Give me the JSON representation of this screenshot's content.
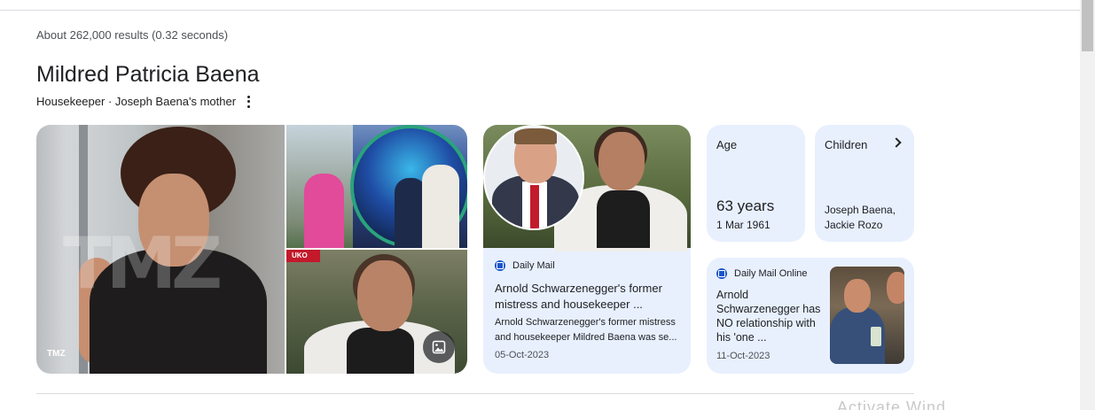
{
  "search": {
    "result_stats": "About 262,000 results (0.32 seconds)"
  },
  "entity": {
    "title": "Mildred Patricia Baena",
    "subtitle": "Housekeeper · Joseph Baena's mother"
  },
  "images": {
    "main_credit": "TMZ",
    "main_watermark": "TMZ",
    "bottom_tag": "UKO"
  },
  "news_card": {
    "source": "Daily Mail",
    "headline": "Arnold Schwarzenegger's former mistress and housekeeper ...",
    "snippet": "Arnold Schwarzenegger's former mistress and housekeeper Mildred Baena was se...",
    "date": "05-Oct-2023"
  },
  "facts": {
    "age_label": "Age",
    "age_value": "63 years",
    "birth_date": "1 Mar 1961",
    "children_label": "Children",
    "children_value": "Joseph Baena, Jackie Rozo"
  },
  "dm_online_card": {
    "source": "Daily Mail Online",
    "headline": "Arnold Schwarzenegger has NO relationship with his 'one ...",
    "date": "11-Oct-2023"
  },
  "overlay": {
    "activate_windows": "Activate Wind"
  },
  "colors": {
    "card_bg": "#e8f0fe",
    "source_logo": "#1a56c9",
    "text": "#202124",
    "muted": "#4d5156"
  }
}
